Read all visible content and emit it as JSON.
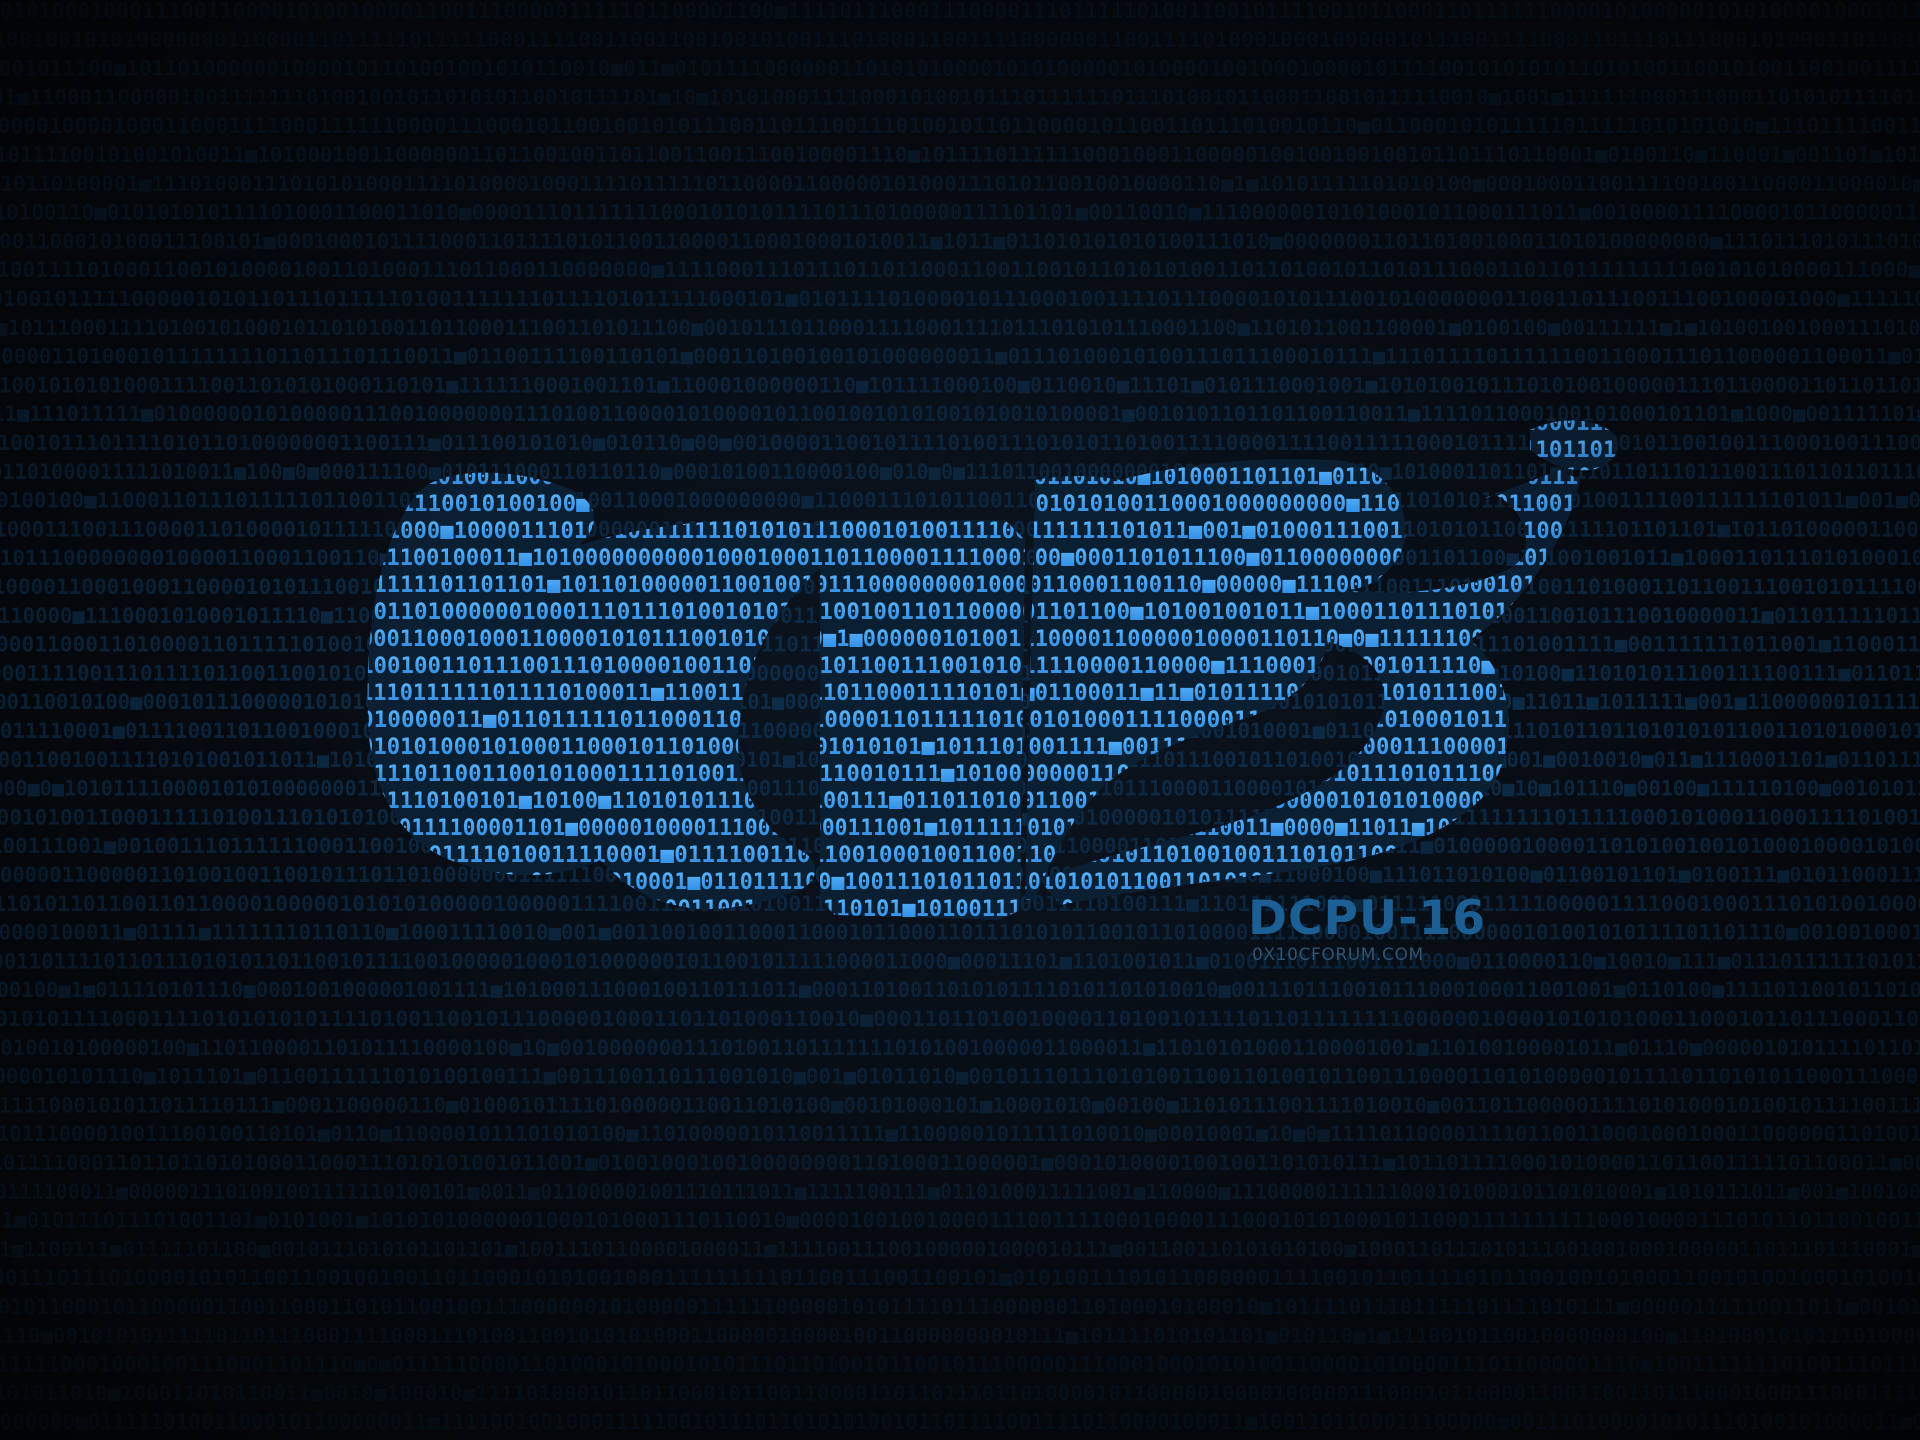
{
  "logo": {
    "title": "DCPU-16",
    "site": "0X10CFORUM.COM"
  },
  "colors": {
    "background": "#06090e",
    "binary_dim": "#0d2f4e",
    "binary_bright": "#2f8fe6",
    "caption_title": "#1b5f95",
    "caption_sub": "#2f5573"
  }
}
